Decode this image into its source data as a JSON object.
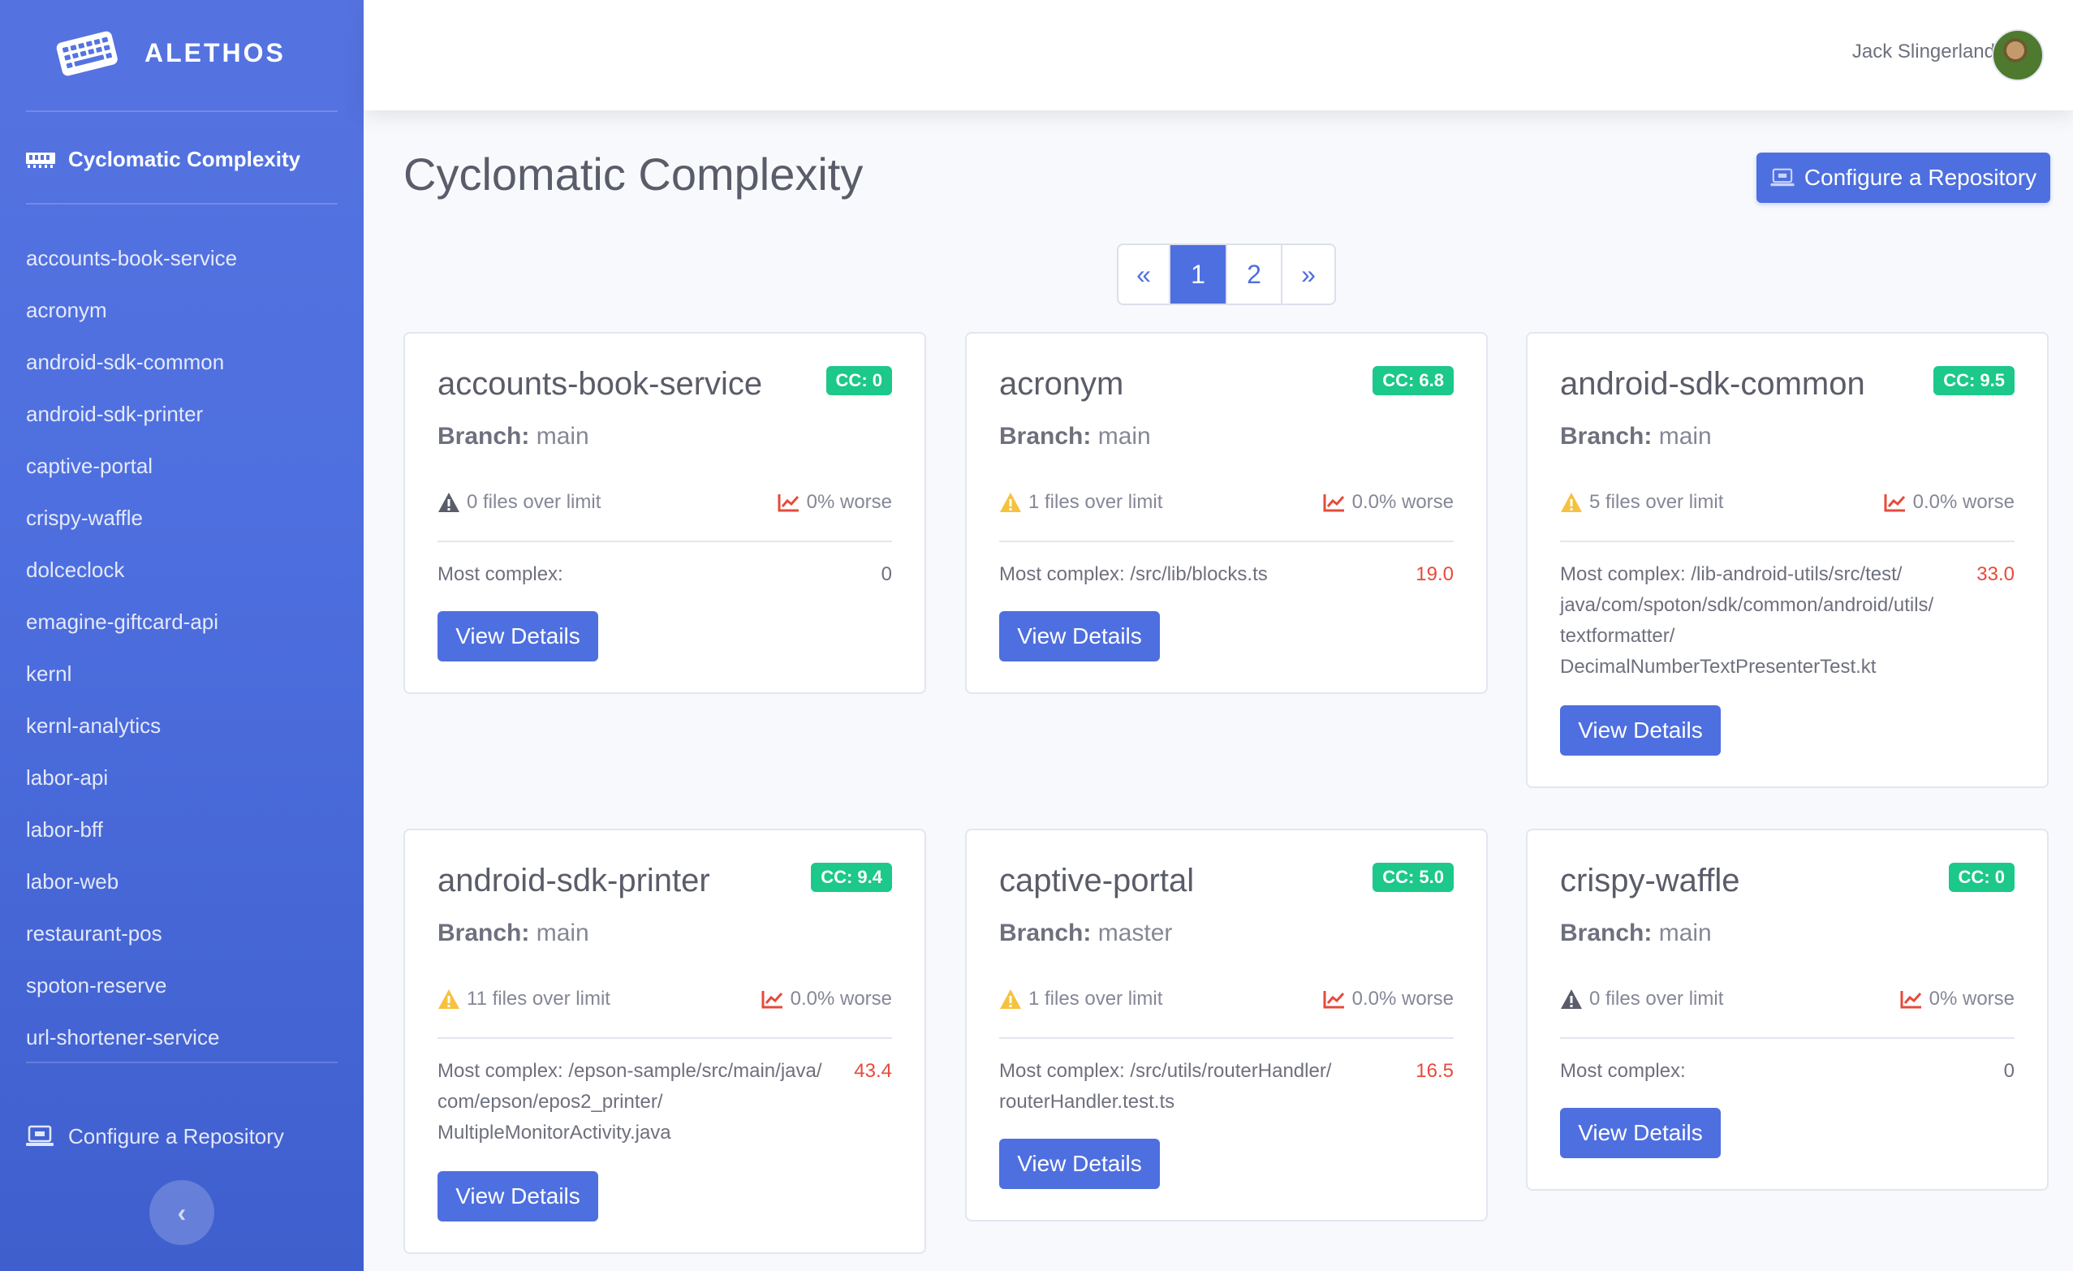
{
  "brand": {
    "name": "ALETHOS",
    "icon": "keyboard-icon"
  },
  "sidebar": {
    "active": {
      "label": "Cyclomatic Complexity",
      "icon": "memory-icon"
    },
    "items": [
      {
        "label": "accounts-book-service"
      },
      {
        "label": "acronym"
      },
      {
        "label": "android-sdk-common"
      },
      {
        "label": "android-sdk-printer"
      },
      {
        "label": "captive-portal"
      },
      {
        "label": "crispy-waffle"
      },
      {
        "label": "dolceclock"
      },
      {
        "label": "emagine-giftcard-api"
      },
      {
        "label": "kernl"
      },
      {
        "label": "kernl-analytics"
      },
      {
        "label": "labor-api"
      },
      {
        "label": "labor-bff"
      },
      {
        "label": "labor-web"
      },
      {
        "label": "restaurant-pos"
      },
      {
        "label": "spoton-reserve"
      },
      {
        "label": "url-shortener-service"
      }
    ],
    "config": {
      "label": "Configure a Repository",
      "icon": "laptop-icon"
    },
    "toggle_icon": "chevron-left-icon"
  },
  "topbar": {
    "user_name": "Jack Slingerland"
  },
  "page": {
    "title": "Cyclomatic Complexity",
    "config_button": "Configure a Repository"
  },
  "pagination": {
    "prev": "«",
    "pages": [
      "1",
      "2"
    ],
    "next": "»",
    "current": "1"
  },
  "common": {
    "branch_label": "Branch:",
    "most_complex_label": "Most complex:",
    "view_details": "View Details"
  },
  "colors": {
    "primary": "#4e6fdf",
    "success": "#1cc88a",
    "danger": "#e74a3b",
    "warning": "#f6c23e"
  },
  "cards": [
    {
      "name": "accounts-book-service",
      "cc": "CC: 0",
      "branch": "main",
      "files_over": "0 files over limit",
      "warn_gray": true,
      "worse": "0% worse",
      "path": "",
      "value": "0"
    },
    {
      "name": "acronym",
      "cc": "CC: 6.8",
      "branch": "main",
      "files_over": "1 files over limit",
      "warn_gray": false,
      "worse": "0.0% worse",
      "path": "/src/lib/blocks.ts",
      "value": "19.0"
    },
    {
      "name": "android-sdk-common",
      "cc": "CC: 9.5",
      "branch": "main",
      "files_over": "5 files over limit",
      "warn_gray": false,
      "worse": "0.0% worse",
      "path": "/lib-android-utils/src/test/ java/com/spoton/sdk/common/android/utils/ textformatter/ DecimalNumberTextPresenterTest.kt",
      "value": "33.0"
    },
    {
      "name": "android-sdk-printer",
      "cc": "CC: 9.4",
      "branch": "main",
      "files_over": "11 files over limit",
      "warn_gray": false,
      "worse": "0.0% worse",
      "path": "/epson-sample/src/main/java/ com/epson/epos2_printer/ MultipleMonitorActivity.java",
      "value": "43.4"
    },
    {
      "name": "captive-portal",
      "cc": "CC: 5.0",
      "branch": "master",
      "files_over": "1 files over limit",
      "warn_gray": false,
      "worse": "0.0% worse",
      "path": "/src/utils/routerHandler/ routerHandler.test.ts",
      "value": "16.5"
    },
    {
      "name": "crispy-waffle",
      "cc": "CC: 0",
      "branch": "main",
      "files_over": "0 files over limit",
      "warn_gray": true,
      "worse": "0% worse",
      "path": "",
      "value": "0"
    }
  ]
}
